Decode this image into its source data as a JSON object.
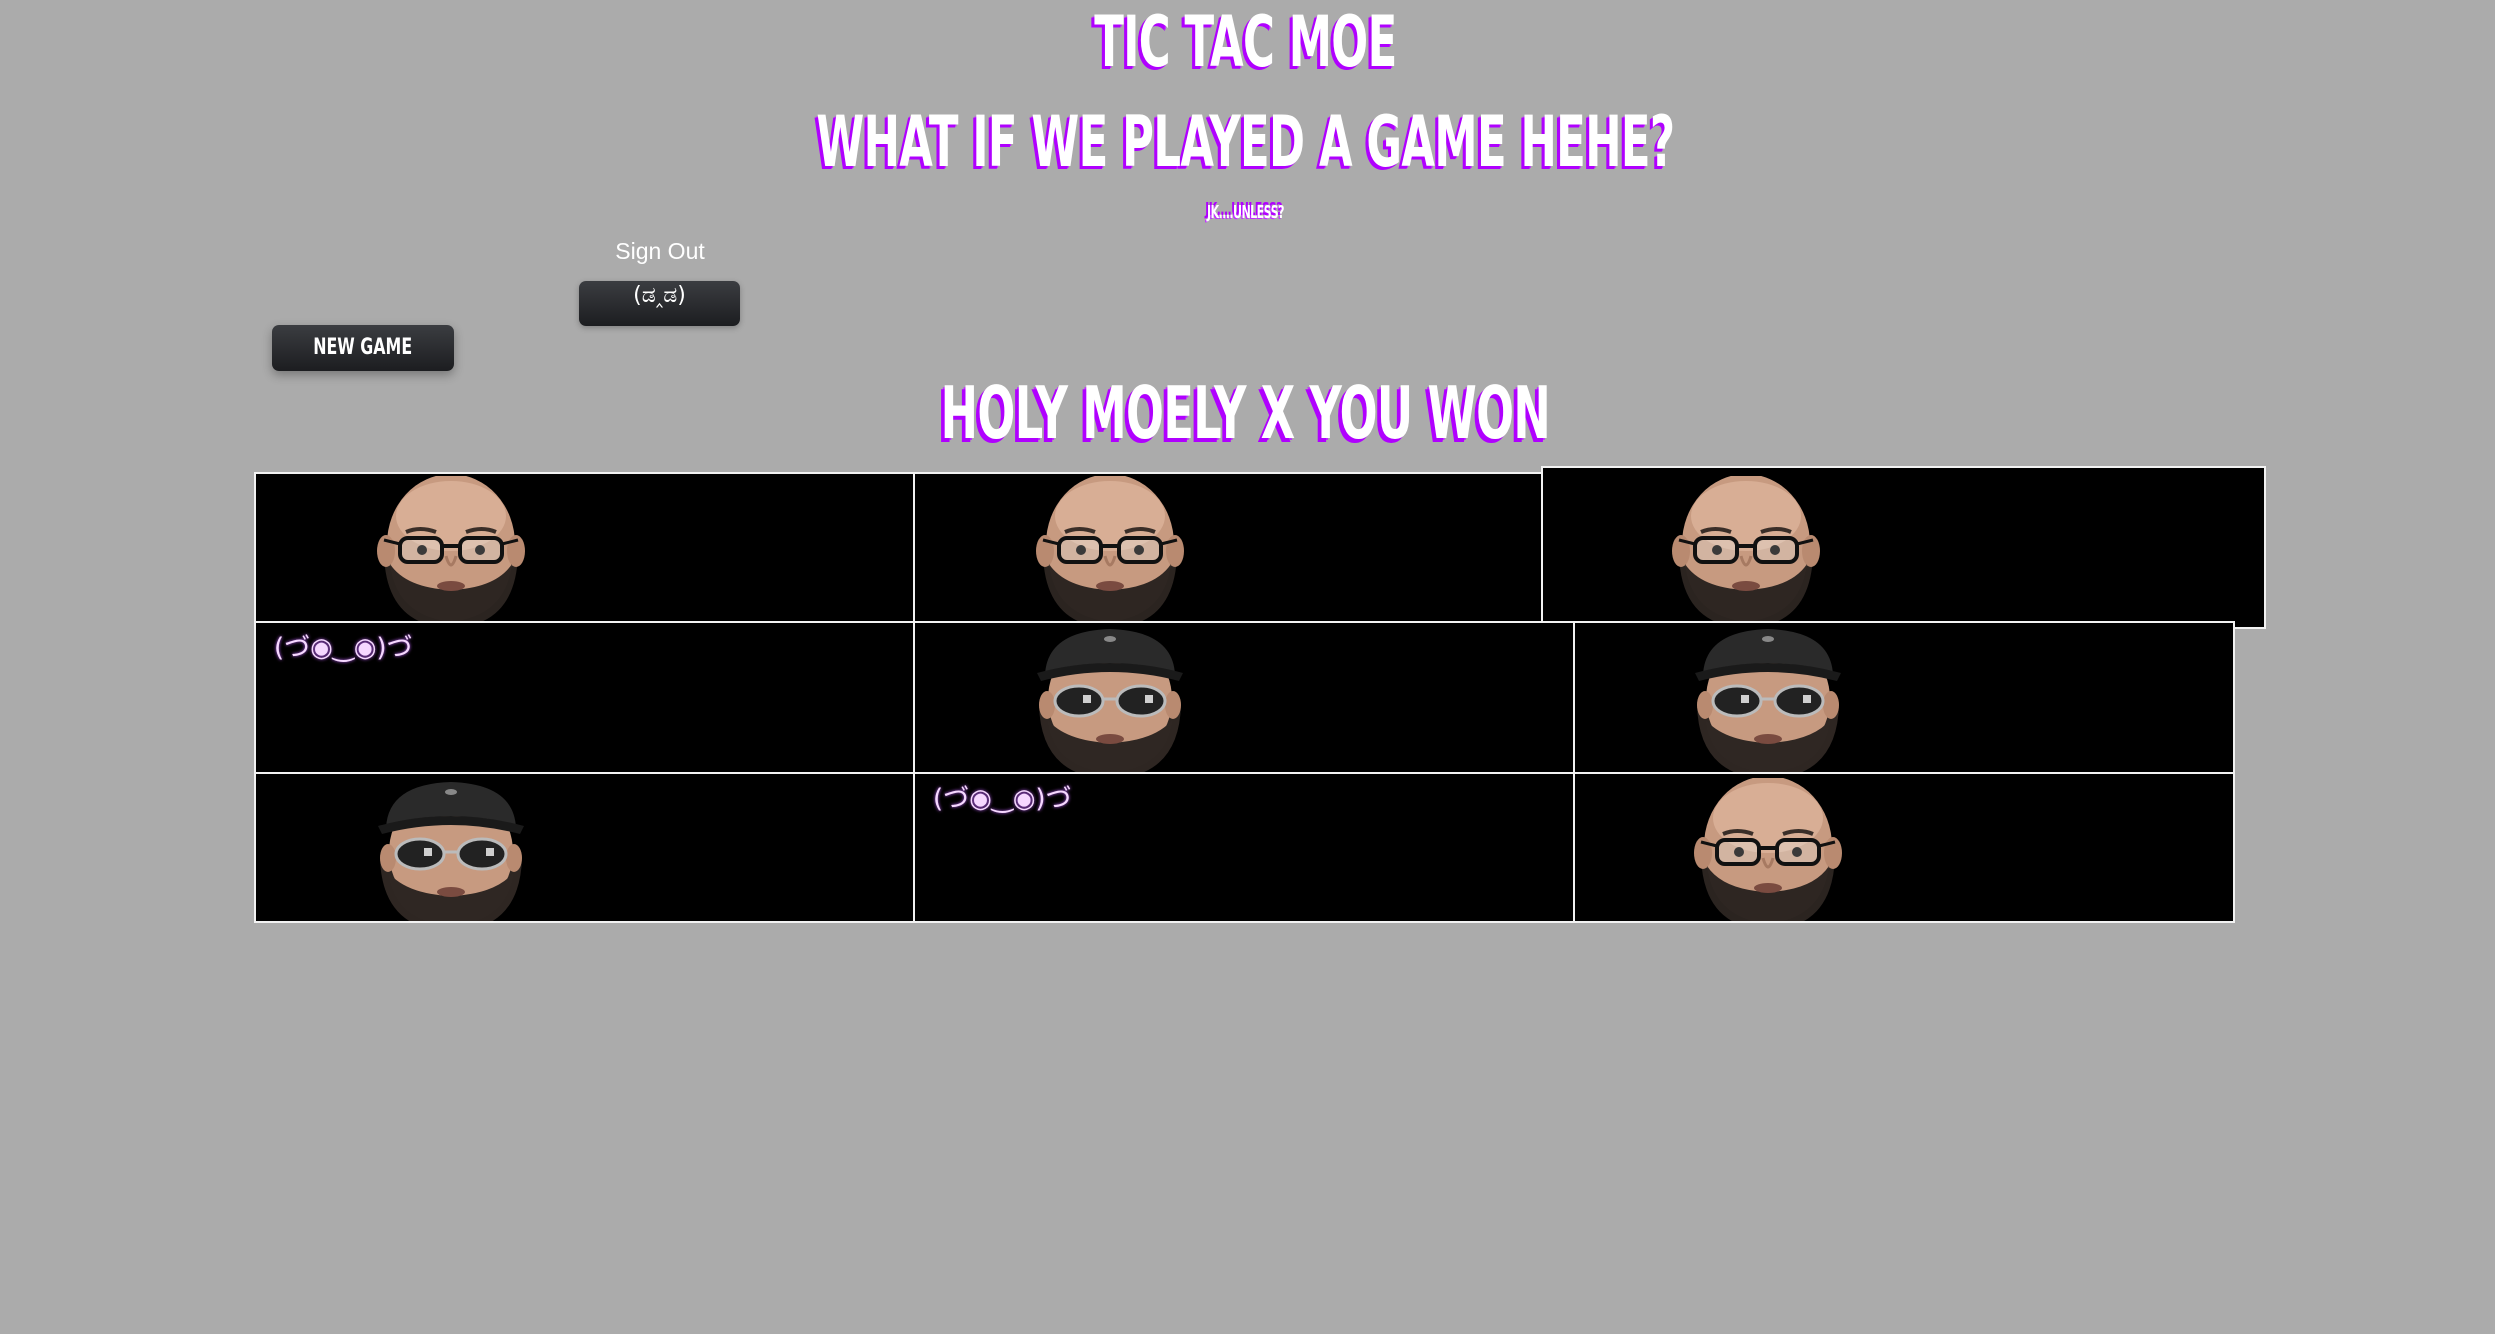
{
  "header": {
    "title": "TIC TAC MOE",
    "subtitle": "WHAT IF WE PLAYED A GAME HEHE?",
    "tagline": "JK....UNLESS?"
  },
  "auth": {
    "sign_out_label": "Sign Out",
    "sign_out_button": "(ಡ‸ಡ)"
  },
  "controls": {
    "new_game_label": "NEW GAME"
  },
  "status": {
    "message": "HOLY MOELY X YOU WON"
  },
  "colors": {
    "background": "#ababab",
    "accent_shadow": "#b000ff",
    "cell_background": "#000000",
    "cell_border": "#f2f2f2",
    "button": "#2a2c30"
  },
  "board": {
    "cells": [
      {
        "content": "face-glasses-icon",
        "text": ""
      },
      {
        "content": "face-glasses-icon",
        "text": ""
      },
      {
        "content": "face-glasses-icon",
        "text": ""
      },
      {
        "content": "emote",
        "text": "(づ◉‿◉)づ"
      },
      {
        "content": "face-cap-sunglasses-icon",
        "text": ""
      },
      {
        "content": "face-cap-sunglasses-icon",
        "text": ""
      },
      {
        "content": "face-cap-sunglasses-icon",
        "text": ""
      },
      {
        "content": "emote",
        "text": "(づ◉‿◉)づ"
      },
      {
        "content": "face-glasses-icon",
        "text": ""
      }
    ]
  }
}
